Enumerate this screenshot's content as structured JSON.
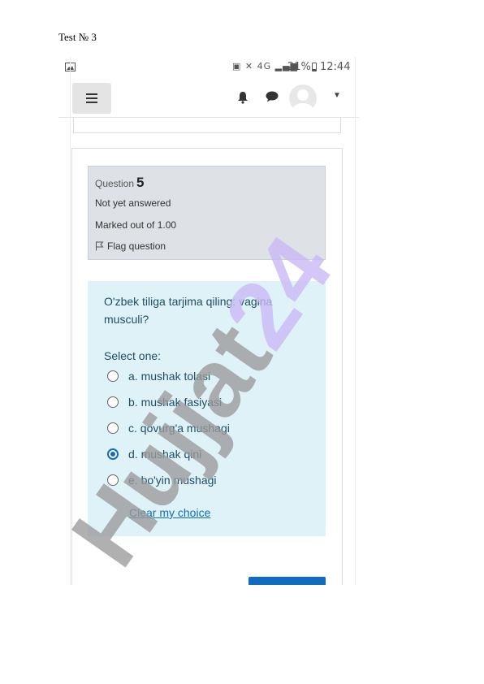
{
  "document": {
    "header": "Test № 3"
  },
  "statusbar": {
    "battery": "21%",
    "time": "12:44",
    "network": "4G"
  },
  "question": {
    "label": "Question",
    "number": "5",
    "state": "Not yet answered",
    "grade": "Marked out of 1.00",
    "flag_label": "Flag question",
    "text": "O'zbek tiligа tarjima qiling: vagina musculi?",
    "prompt": "Select one:",
    "answers": [
      {
        "label": "a. mushak tolasi",
        "selected": false
      },
      {
        "label": "b. mushak fasiyasi",
        "selected": false
      },
      {
        "label": "c. qovurg'a mushagi",
        "selected": false
      },
      {
        "label": "d. mushak qini",
        "selected": true
      },
      {
        "label": "e. bo'yin mushagi",
        "selected": false
      }
    ],
    "clear_label": "Clear my choice"
  },
  "watermark": {
    "text": "Hujjat24"
  },
  "colors": {
    "accent": "#0f6cbf",
    "answer_bg": "#def2f8",
    "info_bg": "#dee2e6",
    "watermark_purple": "#c9b8f5",
    "watermark_gray": "#9a9a9a"
  }
}
